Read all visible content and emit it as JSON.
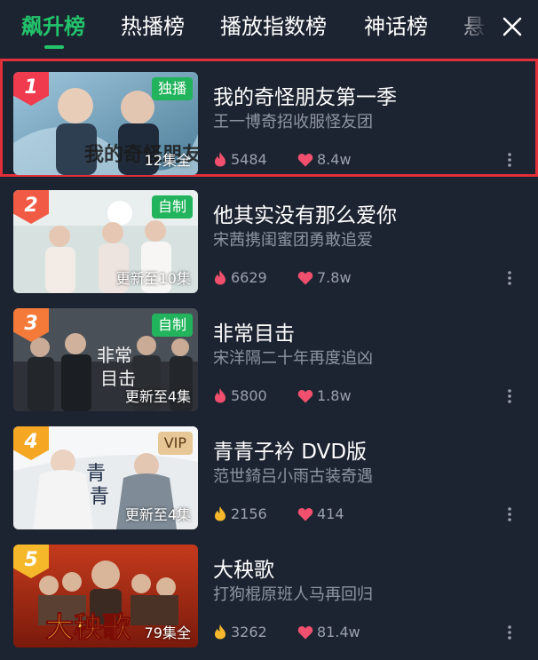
{
  "tabs": [
    {
      "label": "飙升榜",
      "active": true
    },
    {
      "label": "热播榜",
      "active": false
    },
    {
      "label": "播放指数榜",
      "active": false
    },
    {
      "label": "神话榜",
      "active": false
    },
    {
      "label": "悬",
      "active": false
    }
  ],
  "close_icon": "close-icon",
  "colors": {
    "accent": "#22c36b",
    "background": "#1d2431",
    "highlight_border": "#e1303a"
  },
  "items": [
    {
      "rank": "1",
      "rank_color": "#f03a4e",
      "title": "我的奇怪朋友第一季",
      "subtitle": "王一博奇招收服怪友团",
      "badge": "独播",
      "badge_type": "green",
      "episodes": "12集全",
      "heat": "5484",
      "heat_icon": "fire-icon-red",
      "likes": "8.4w",
      "highlighted": true
    },
    {
      "rank": "2",
      "rank_color": "#f15a45",
      "title": "他其实没有那么爱你",
      "subtitle": "宋茜携闺蜜团勇敢追爱",
      "badge": "自制",
      "badge_type": "green",
      "episodes": "更新至10集",
      "heat": "6629",
      "heat_icon": "fire-icon-red",
      "likes": "7.8w",
      "highlighted": false
    },
    {
      "rank": "3",
      "rank_color": "#f47a3a",
      "title": "非常目击",
      "subtitle": "宋洋隔二十年再度追凶",
      "badge": "自制",
      "badge_type": "green",
      "episodes": "更新至4集",
      "heat": "5800",
      "heat_icon": "fire-icon-red",
      "likes": "1.8w",
      "highlighted": false
    },
    {
      "rank": "4",
      "rank_color": "#f5a623",
      "title": "青青子衿 DVD版",
      "subtitle": "范世錡吕小雨古装奇遇",
      "badge": "VIP",
      "badge_type": "vip",
      "episodes": "更新至4集",
      "heat": "2156",
      "heat_icon": "fire-icon-yellow",
      "likes": "414",
      "highlighted": false
    },
    {
      "rank": "5",
      "rank_color": "#f5b82a",
      "title": "大秧歌",
      "subtitle": "打狗棍原班人马再回归",
      "badge": "",
      "badge_type": "",
      "episodes": "79集全",
      "heat": "3262",
      "heat_icon": "fire-icon-yellow",
      "likes": "81.4w",
      "highlighted": false
    }
  ]
}
